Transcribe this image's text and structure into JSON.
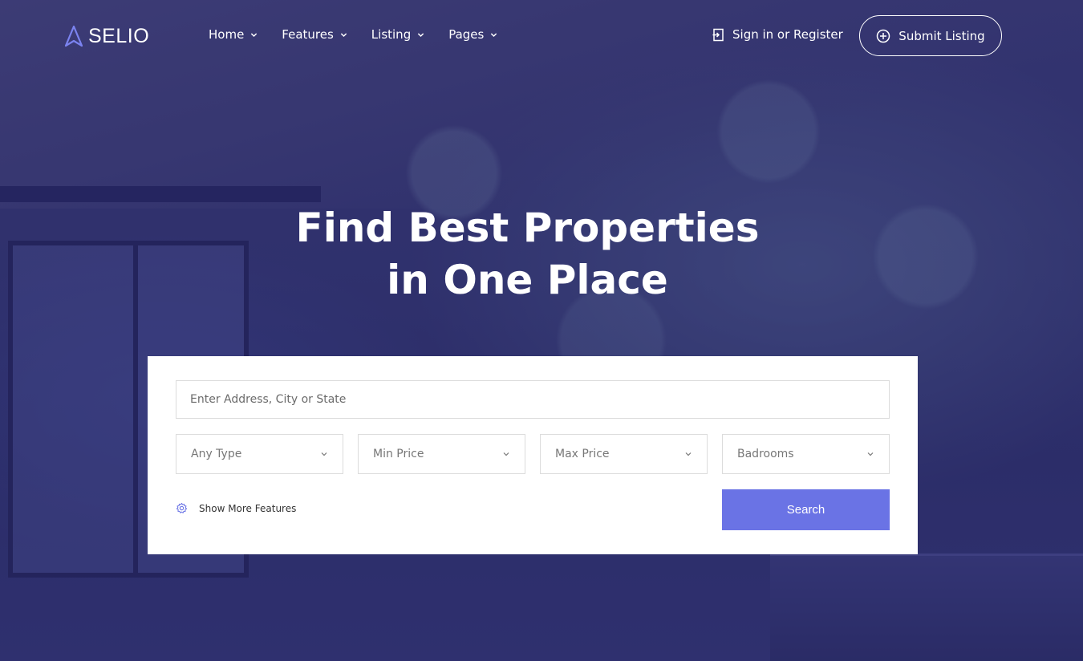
{
  "brand": {
    "name": "SELIO",
    "accent": "#6a73e5"
  },
  "nav": {
    "items": [
      {
        "label": "Home",
        "icon": "chevron-down-icon"
      },
      {
        "label": "Features",
        "icon": "chevron-down-icon"
      },
      {
        "label": "Listing",
        "icon": "chevron-down-icon"
      },
      {
        "label": "Pages",
        "icon": "chevron-down-icon"
      }
    ],
    "signin_label": "Sign in or Register",
    "signin_icon": "sign-in-icon",
    "submit_label": "Submit Listing",
    "submit_icon": "plus-circle-icon"
  },
  "hero": {
    "title_line1": "Find Best Properties",
    "title_line2": "in One Place"
  },
  "search": {
    "address_placeholder": "Enter Address, City or State",
    "selects": [
      {
        "label": "Any Type"
      },
      {
        "label": "Min Price"
      },
      {
        "label": "Max Price"
      },
      {
        "label": "Badrooms"
      }
    ],
    "more_features_label": "Show More Features",
    "more_features_icon": "gear-icon",
    "search_button_label": "Search",
    "button_color": "#6a73e5"
  }
}
